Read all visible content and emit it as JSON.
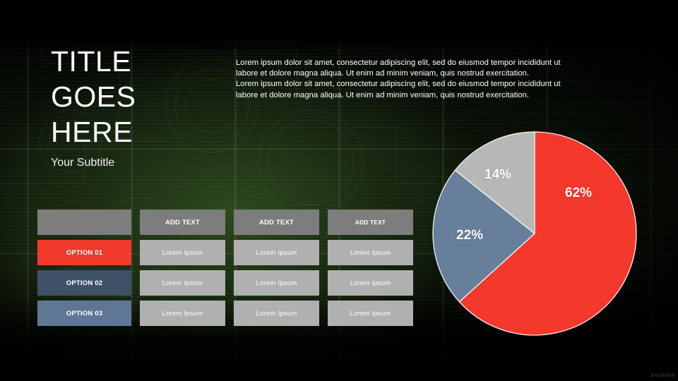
{
  "slide": {
    "title_lines": [
      "TITLE",
      "GOES",
      "HERE"
    ],
    "subtitle": "Your Subtitle",
    "body_paragraphs": [
      "Lorem ipsum dolor sit amet, consectetur adipiscing elit, sed do eiusmod tempor incididunt ut labore et dolore magna aliqua. Ut enim ad minim veniam, quis nostrud exercitation.",
      "Lorem ipsum dolor sit amet, consectetur adipiscing elit, sed do eiusmod tempor incididunt ut labore et dolore magna aliqua. Ut enim ad minim veniam, quis nostrud exercitation."
    ],
    "watermark": "SAGEFOX"
  },
  "table": {
    "headers": [
      "",
      "ADD TEXT",
      "ADD TEXT",
      "ADD TEXT"
    ],
    "rows": [
      {
        "label": "OPTION 01",
        "label_color": "#ef3a2c",
        "cells": [
          "Lorem Ipsum",
          "Lorem Ipsum",
          "Lorem Ipsum"
        ]
      },
      {
        "label": "OPTION 02",
        "label_color": "#3f5167",
        "cells": [
          "Lorem Ipsum",
          "Lorem Ipsum",
          "Lorem Ipsum"
        ]
      },
      {
        "label": "OPTION 03",
        "label_color": "#5f7795",
        "cells": [
          "Lorem Ipsum",
          "Lorem Ipsum",
          "Lorem Ipsum"
        ]
      }
    ]
  },
  "chart_data": {
    "type": "pie",
    "title": "",
    "categories": [
      "Option 01",
      "Option 02",
      "Option 03"
    ],
    "values": [
      62,
      22,
      14
    ],
    "labels": [
      "62%",
      "22%",
      "14%"
    ],
    "colors": [
      "#f4382b",
      "#687f9c",
      "#b7b7b7"
    ],
    "start_angle_deg": 0,
    "direction": "clockwise",
    "legend": "none",
    "grid": false
  }
}
